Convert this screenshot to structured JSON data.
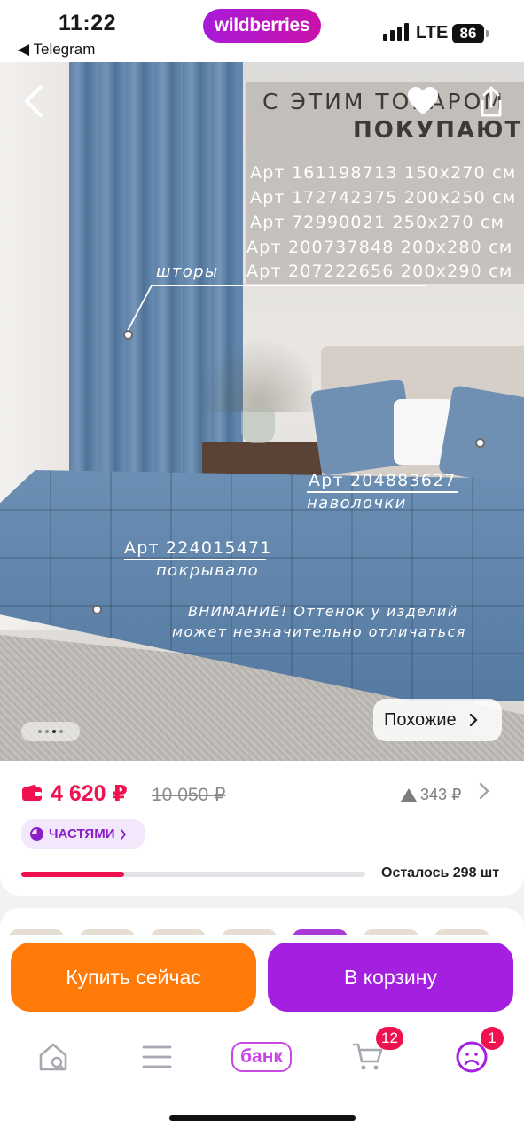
{
  "status_bar": {
    "time": "11:22",
    "back_app": "◀ Telegram",
    "brand": "wildberries",
    "network": "LTE",
    "battery": "86"
  },
  "gallery": {
    "header_line1": "С ЭТИМ ТОВАРОМ",
    "header_line2": "ПОКУПАЮТ",
    "curtain_articles": [
      "Арт 161198713    150х270 см",
      "Арт 172742375   200х250 см",
      "Арт 72990021    250х270 см",
      "Арт 200737848  200х280 см"
    ],
    "curtain_label": "шторы",
    "curtain_last_article": "Арт 207222656  200х290 см",
    "pillowcase_article": "Арт 204883627",
    "pillowcase_label": "наволочки",
    "bedspread_article": "Арт 224015471",
    "bedspread_label": "покрывало",
    "warning_line1": "ВНИМАНИЕ! Оттенок у изделий",
    "warning_line2": "может незначительно отличаться",
    "similar_button": "Похожие",
    "slide_count": 4,
    "active_slide": 3
  },
  "price": {
    "current": "4 620 ₽",
    "old": "10 050 ₽",
    "delta": "343 ₽",
    "installments": "ЧАСТЯМИ",
    "stock_text": "Осталось 298 шт",
    "stock_fraction": 0.3
  },
  "actions": {
    "buy_now": "Купить сейчас",
    "add_to_cart": "В корзину"
  },
  "tabbar": {
    "bank_label": "банк",
    "cart_badge": "12",
    "profile_badge": "1"
  },
  "colors": {
    "accent_purple": "#a51fe0",
    "buy_orange": "#ff7a08",
    "price_red": "#f0124f"
  }
}
